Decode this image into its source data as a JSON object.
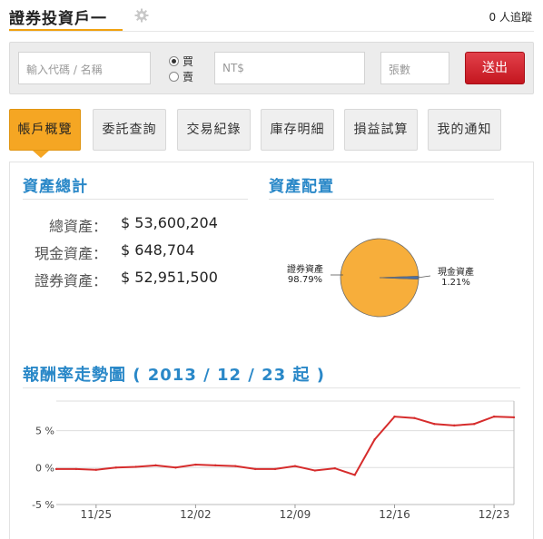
{
  "header": {
    "account_title": "證券投資戶一",
    "followers": "0 人追蹤"
  },
  "order_form": {
    "code_placeholder": "輸入代碼 / 名稱",
    "buy_label": "買",
    "sell_label": "賣",
    "selected_side": "buy",
    "price_placeholder": "NT$",
    "quantity_placeholder": "張數",
    "submit_label": "送出"
  },
  "tabs": [
    {
      "label": "帳戶概覽",
      "active": true
    },
    {
      "label": "委託查詢",
      "active": false
    },
    {
      "label": "交易紀錄",
      "active": false
    },
    {
      "label": "庫存明細",
      "active": false
    },
    {
      "label": "損益試算",
      "active": false
    },
    {
      "label": "我的通知",
      "active": false
    }
  ],
  "assets": {
    "title": "資產總計",
    "rows": [
      {
        "label": "總資產：",
        "value": "$ 53,600,204"
      },
      {
        "label": "現金資產：",
        "value": "$ 648,704"
      },
      {
        "label": "證券資產：",
        "value": "$ 52,951,500"
      }
    ]
  },
  "allocation": {
    "title": "資產配置",
    "slices": [
      {
        "label": "證券資產",
        "percent_text": "98.79%",
        "value": 98.79,
        "color": "#f7ae3b"
      },
      {
        "label": "現金資產",
        "percent_text": "1.21%",
        "value": 1.21,
        "color": "#4a6fa5"
      }
    ]
  },
  "return_chart": {
    "title": "報酬率走勢圖 ( 2013 / 12 / 23 起 )"
  },
  "chart_data": {
    "type": "line",
    "title": "",
    "x": [
      "11/21",
      "11/22",
      "11/25",
      "11/26",
      "11/27",
      "11/28",
      "11/29",
      "12/02",
      "12/03",
      "12/04",
      "12/05",
      "12/06",
      "12/09",
      "12/10",
      "12/11",
      "12/12",
      "12/13",
      "12/16",
      "12/17",
      "12/18",
      "12/19",
      "12/20",
      "12/23",
      "12/24"
    ],
    "series": [
      {
        "color": "#d62c2c",
        "values": [
          -0.2,
          -0.2,
          -0.3,
          0.0,
          0.1,
          0.3,
          0.0,
          0.4,
          0.3,
          0.2,
          -0.2,
          -0.2,
          0.2,
          -0.4,
          -0.1,
          -1.0,
          3.8,
          6.9,
          6.7,
          5.9,
          5.7,
          5.9,
          6.9,
          6.8
        ]
      }
    ],
    "xticks": [
      "11/25",
      "12/02",
      "12/09",
      "12/16",
      "12/23"
    ],
    "yticks": [
      "5 %",
      "0 %",
      "-5 %"
    ],
    "ylim": [
      -5,
      9
    ],
    "grid": true
  }
}
